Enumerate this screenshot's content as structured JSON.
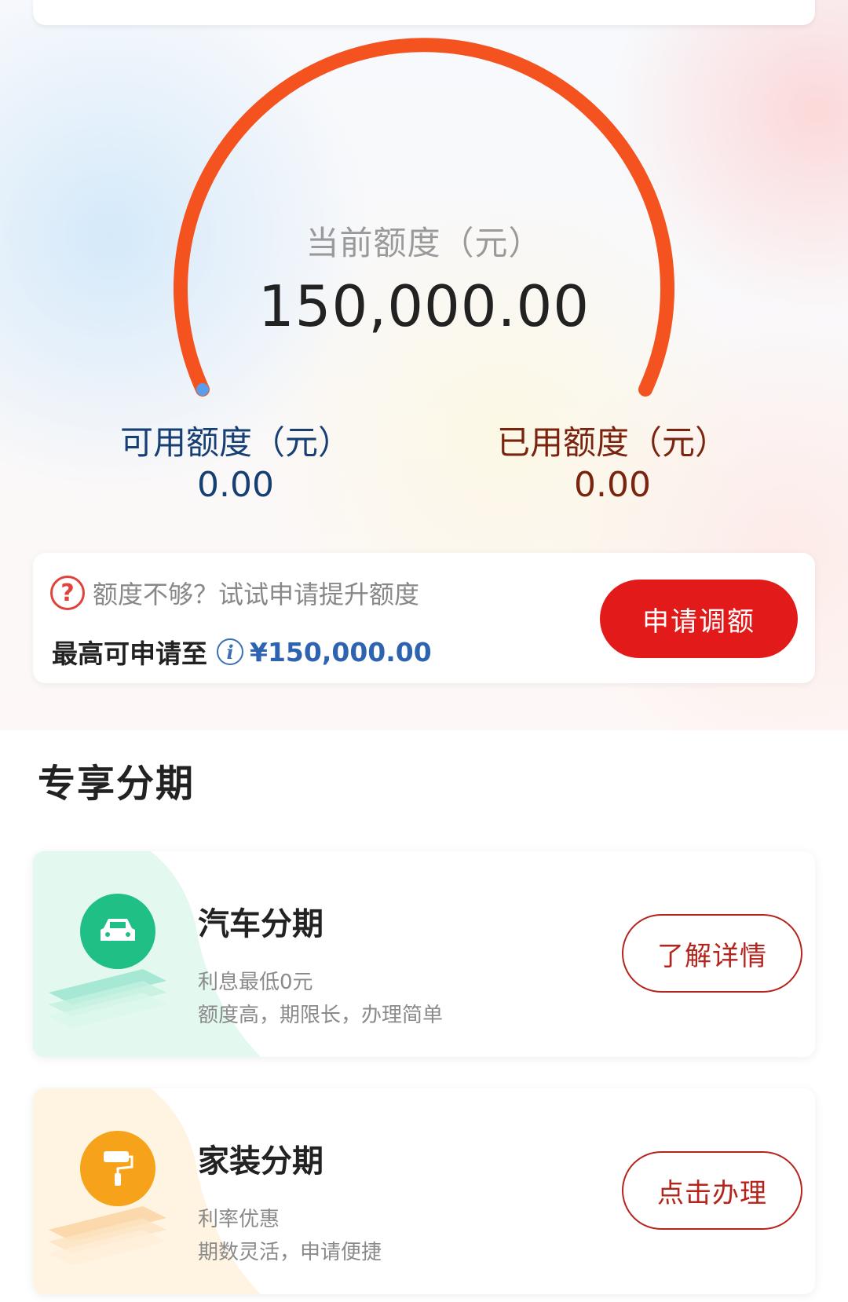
{
  "gauge": {
    "label": "当前额度（元）",
    "value": "150,000.00",
    "fill_fraction": 1.0,
    "color": "#f4521e"
  },
  "available": {
    "label": "可用额度（元）",
    "value": "0.00"
  },
  "used": {
    "label": "已用额度（元）",
    "value": "0.00"
  },
  "raise": {
    "tip": "额度不够？试试申请提升额度",
    "max_label": "最高可申请至",
    "max_amount": "¥150,000.00",
    "button": "申请调额",
    "button_color": "#e21a1a"
  },
  "section": {
    "title": "专享分期"
  },
  "products": [
    {
      "title": "汽车分期",
      "desc1": "利息最低0元",
      "desc2": "额度高，期限长，办理简单",
      "button": "了解详情",
      "icon": "car-icon",
      "color": "#1fbf86"
    },
    {
      "title": "家装分期",
      "desc1": "利率优惠",
      "desc2": "期数灵活，申请便捷",
      "button": "点击办理",
      "icon": "paint-roller-icon",
      "color": "#f7a21b"
    }
  ]
}
